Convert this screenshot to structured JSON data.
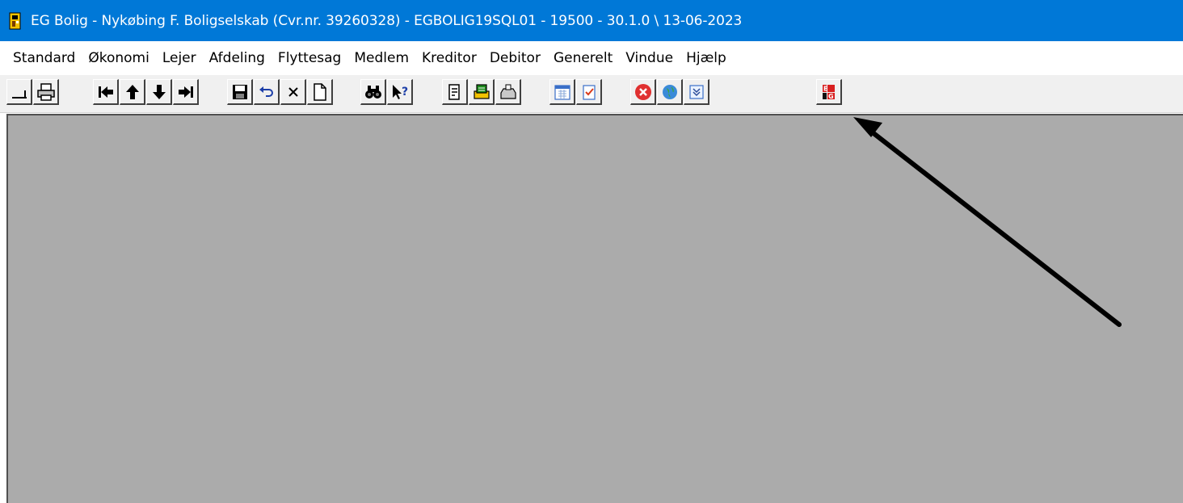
{
  "window": {
    "title": "EG Bolig  - Nykøbing F. Boligselskab (Cvr.nr. 39260328) - EGBOLIG19SQL01 - 19500 - 30.1.0 \\ 13-06-2023",
    "icon": "app-logo-icon"
  },
  "menu": {
    "items": [
      {
        "label": "Standard"
      },
      {
        "label": "Økonomi"
      },
      {
        "label": "Lejer"
      },
      {
        "label": "Afdeling"
      },
      {
        "label": "Flyttesag"
      },
      {
        "label": "Medlem"
      },
      {
        "label": "Kreditor"
      },
      {
        "label": "Debitor"
      },
      {
        "label": "Generelt"
      },
      {
        "label": "Vindue"
      },
      {
        "label": "Hjælp"
      }
    ]
  },
  "toolbar": {
    "buttons": [
      {
        "icon": "minimize-icon"
      },
      {
        "icon": "print-icon"
      },
      {
        "icon": "first-record-icon"
      },
      {
        "icon": "previous-record-icon"
      },
      {
        "icon": "next-record-icon"
      },
      {
        "icon": "last-record-icon"
      },
      {
        "icon": "save-icon"
      },
      {
        "icon": "undo-icon"
      },
      {
        "icon": "delete-icon"
      },
      {
        "icon": "new-document-icon"
      },
      {
        "icon": "find-icon"
      },
      {
        "icon": "context-help-icon"
      },
      {
        "icon": "notes-icon"
      },
      {
        "icon": "print-preview-icon"
      },
      {
        "icon": "inbox-icon"
      },
      {
        "icon": "calendar-icon"
      },
      {
        "icon": "checklist-icon"
      },
      {
        "icon": "close-red-icon"
      },
      {
        "icon": "globe-icon"
      },
      {
        "icon": "expand-down-icon"
      },
      {
        "icon": "eg-logo-icon"
      }
    ]
  },
  "colors": {
    "titlebar": "#0078d7",
    "workspace": "#ababab",
    "annotation_arrow": "#000000"
  }
}
